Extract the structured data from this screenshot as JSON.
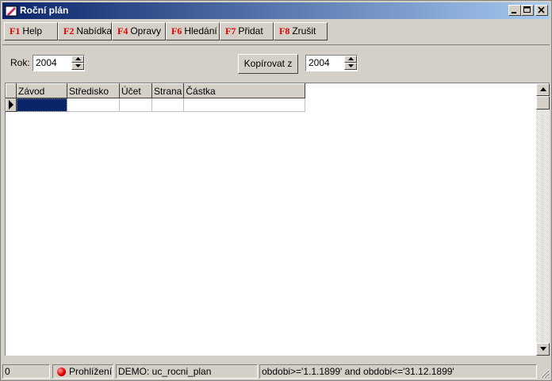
{
  "window": {
    "title": "Roční plán"
  },
  "function_keys": [
    {
      "key": "F1",
      "label": "Help"
    },
    {
      "key": "F2",
      "label": "Nabídka"
    },
    {
      "key": "F4",
      "label": "Opravy"
    },
    {
      "key": "F6",
      "label": "Hledání"
    },
    {
      "key": "F7",
      "label": "Přidat"
    },
    {
      "key": "F8",
      "label": "Zrušit"
    }
  ],
  "filter": {
    "year_label": "Rok:",
    "year_value": "2004",
    "copy_button": "Kopírovat z",
    "copy_year_value": "2004"
  },
  "grid": {
    "columns": [
      "Závod",
      "Středisko",
      "Účet",
      "Strana",
      "Částka"
    ]
  },
  "status": {
    "count": "0",
    "mode": "Prohlížení",
    "module": "DEMO: uc_rocni_plan",
    "filter_expr": "obdobi>='1.1.1899' and obdobi<='31.12.1899'"
  },
  "colors": {
    "title_start": "#0a246a",
    "title_end": "#a6caf0",
    "fkey_red": "#e00000",
    "selected_cell": "#0a246a"
  }
}
